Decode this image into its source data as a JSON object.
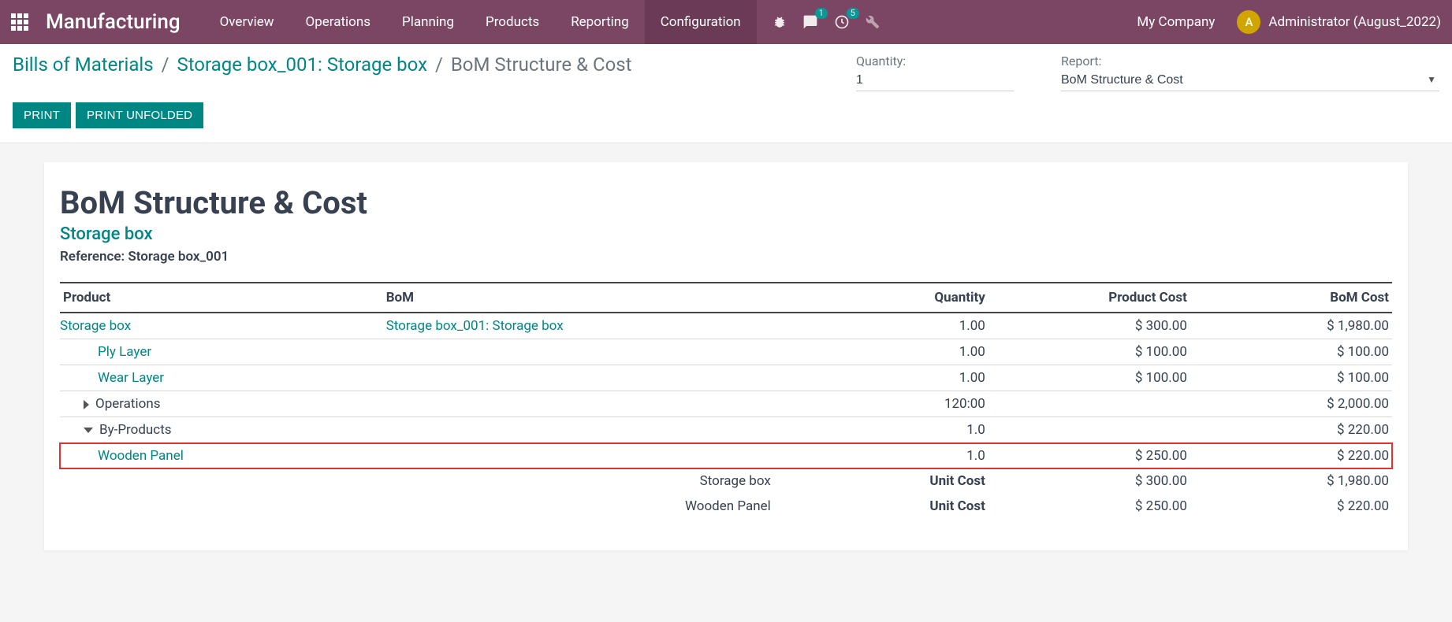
{
  "nav": {
    "module": "Manufacturing",
    "items": [
      "Overview",
      "Operations",
      "Planning",
      "Products",
      "Reporting",
      "Configuration"
    ],
    "active": 5,
    "chat_badge": "1",
    "activity_badge": "5",
    "company": "My Company",
    "user": "Administrator (August_2022)",
    "avatar_letter": "A"
  },
  "breadcrumbs": {
    "a": "Bills of Materials",
    "b": "Storage box_001: Storage box",
    "c": "BoM Structure & Cost"
  },
  "controls": {
    "qty_label": "Quantity:",
    "qty_value": "1",
    "report_label": "Report:",
    "report_value": "BoM Structure & Cost",
    "print": "PRINT",
    "print_unfolded": "PRINT UNFOLDED"
  },
  "report": {
    "title": "BoM Structure & Cost",
    "subtitle": "Storage box",
    "reference": "Reference: Storage box_001",
    "headers": {
      "product": "Product",
      "bom": "BoM",
      "qty": "Quantity",
      "pcost": "Product Cost",
      "bcost": "BoM Cost"
    },
    "rows": [
      {
        "indent": 0,
        "type": "link",
        "product": "Storage box",
        "bom": "Storage box_001: Storage box",
        "qty": "1.00",
        "pcost": "$ 300.00",
        "bcost": "$ 1,980.00"
      },
      {
        "indent": 1,
        "type": "link",
        "product": "Ply Layer",
        "bom": "",
        "qty": "1.00",
        "pcost": "$ 100.00",
        "bcost": "$ 100.00"
      },
      {
        "indent": 1,
        "type": "link",
        "product": "Wear Layer",
        "bom": "",
        "qty": "1.00",
        "pcost": "$ 100.00",
        "bcost": "$ 100.00"
      },
      {
        "indent": 0,
        "type": "expand",
        "expanded": false,
        "product": "Operations",
        "bom": "",
        "qty": "120:00",
        "pcost": "",
        "bcost": "$ 2,000.00"
      },
      {
        "indent": 0,
        "type": "expand",
        "expanded": true,
        "product": "By-Products",
        "bom": "",
        "qty": "1.0",
        "pcost": "",
        "bcost": "$ 220.00"
      },
      {
        "indent": 1,
        "type": "link",
        "highlight": true,
        "product": "Wooden Panel",
        "bom": "",
        "qty": "1.0",
        "pcost": "$ 250.00",
        "bcost": "$ 220.00"
      }
    ],
    "footer": [
      {
        "label": "Storage box",
        "unit": "Unit Cost",
        "pcost": "$ 300.00",
        "bcost": "$ 1,980.00"
      },
      {
        "label": "Wooden Panel",
        "unit": "Unit Cost",
        "pcost": "$ 250.00",
        "bcost": "$ 220.00"
      }
    ]
  }
}
